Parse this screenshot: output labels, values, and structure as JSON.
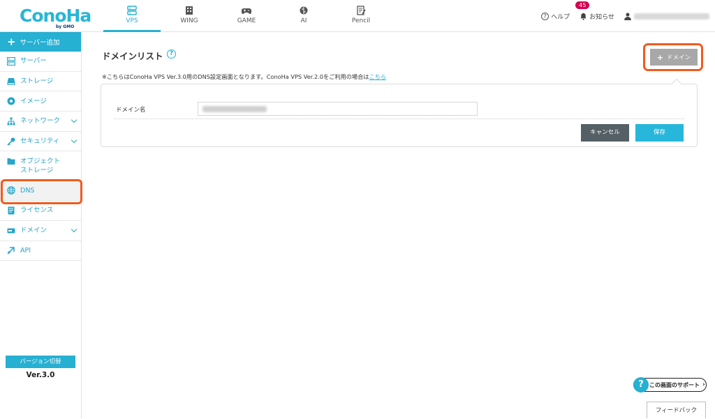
{
  "header": {
    "logo_text": "ConoHa",
    "logo_sub": "by GMO",
    "tabs": [
      {
        "label": "VPS",
        "icon": "server-icon"
      },
      {
        "label": "WING",
        "icon": "building-icon"
      },
      {
        "label": "GAME",
        "icon": "gamepad-icon"
      },
      {
        "label": "AI",
        "icon": "brain-icon"
      },
      {
        "label": "Pencil",
        "icon": "pencil-icon"
      }
    ],
    "active_tab": "VPS",
    "help_label": "ヘルプ",
    "notice_label": "お知らせ",
    "notice_count": "45"
  },
  "sidebar": {
    "add_server": "サーバー追加",
    "items": [
      {
        "label": "サーバー",
        "icon": "server-icon"
      },
      {
        "label": "ストレージ",
        "icon": "storage-icon"
      },
      {
        "label": "イメージ",
        "icon": "image-icon"
      },
      {
        "label": "ネットワーク",
        "icon": "network-icon"
      },
      {
        "label": "セキュリティ",
        "icon": "key-icon"
      },
      {
        "label": "オブジェクト\nストレージ",
        "line1": "オブジェクト",
        "line2": "ストレージ",
        "icon": "folder-icon"
      },
      {
        "label": "DNS",
        "icon": "globe-icon"
      },
      {
        "label": "ライセンス",
        "icon": "license-icon"
      },
      {
        "label": "ドメイン",
        "icon": "domain-icon"
      },
      {
        "label": "API",
        "icon": "api-icon"
      }
    ],
    "version_switch": "バージョン切替",
    "version": "Ver.3.0"
  },
  "main": {
    "title": "ドメインリスト",
    "notice_prefix": "※こちらはConoHa VPS Ver.3.0用のDNS設定画面となります。ConoHa VPS Ver.2.0をご利用の場合は",
    "notice_link": "こちら",
    "add_domain_label": "ドメイン",
    "form": {
      "domain_label": "ドメイン名",
      "cancel_label": "キャンセル",
      "save_label": "保存"
    },
    "support_label": "この画面のサポート",
    "feedback_label": "フィードバック"
  },
  "colors": {
    "accent": "#26b0d2",
    "highlight": "#f15a1e",
    "cancel_bg": "#555f66",
    "badge": "#d6004f"
  }
}
